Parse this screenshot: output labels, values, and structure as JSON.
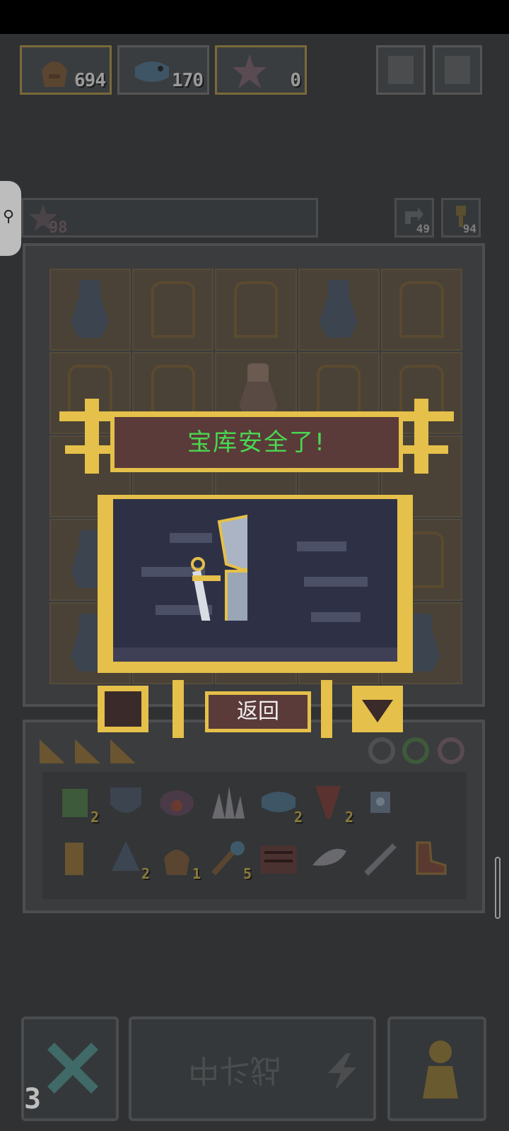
{
  "resources": [
    {
      "icon": "bread-bag-icon",
      "value": "694"
    },
    {
      "icon": "fish-icon",
      "value": "170"
    },
    {
      "icon": "star-shard-icon",
      "value": "0"
    }
  ],
  "top_buttons": [
    {
      "icon": "help-question-icon"
    },
    {
      "icon": "settings-gear-icon"
    }
  ],
  "secondary": {
    "star_value": "98",
    "refresh_value": "49",
    "key_value": "94"
  },
  "modal": {
    "title": "宝库安全了!",
    "back_label": "返回"
  },
  "inventory": {
    "items": [
      {
        "icon": "green-potion-icon",
        "count": "2"
      },
      {
        "icon": "shield-icon",
        "count": ""
      },
      {
        "icon": "crab-bowl-icon",
        "count": ""
      },
      {
        "icon": "crystal-spikes-icon",
        "count": ""
      },
      {
        "icon": "blue-fish-icon",
        "count": "2"
      },
      {
        "icon": "red-horn-icon",
        "count": "2"
      },
      {
        "icon": "robot-trinket-icon",
        "count": ""
      },
      {
        "icon": "scroll-icon",
        "count": ""
      },
      {
        "icon": "pine-tree-icon",
        "count": "2"
      },
      {
        "icon": "bread-bag-icon",
        "count": "1"
      },
      {
        "icon": "magic-orb-staff-icon",
        "count": "5"
      },
      {
        "icon": "bookshelf-icon",
        "count": ""
      },
      {
        "icon": "wing-feather-icon",
        "count": ""
      },
      {
        "icon": "sword-icon",
        "count": ""
      },
      {
        "icon": "boot-icon",
        "count": ""
      }
    ]
  },
  "bottom": {
    "battle_label": "战斗中",
    "turn_number": "3"
  }
}
